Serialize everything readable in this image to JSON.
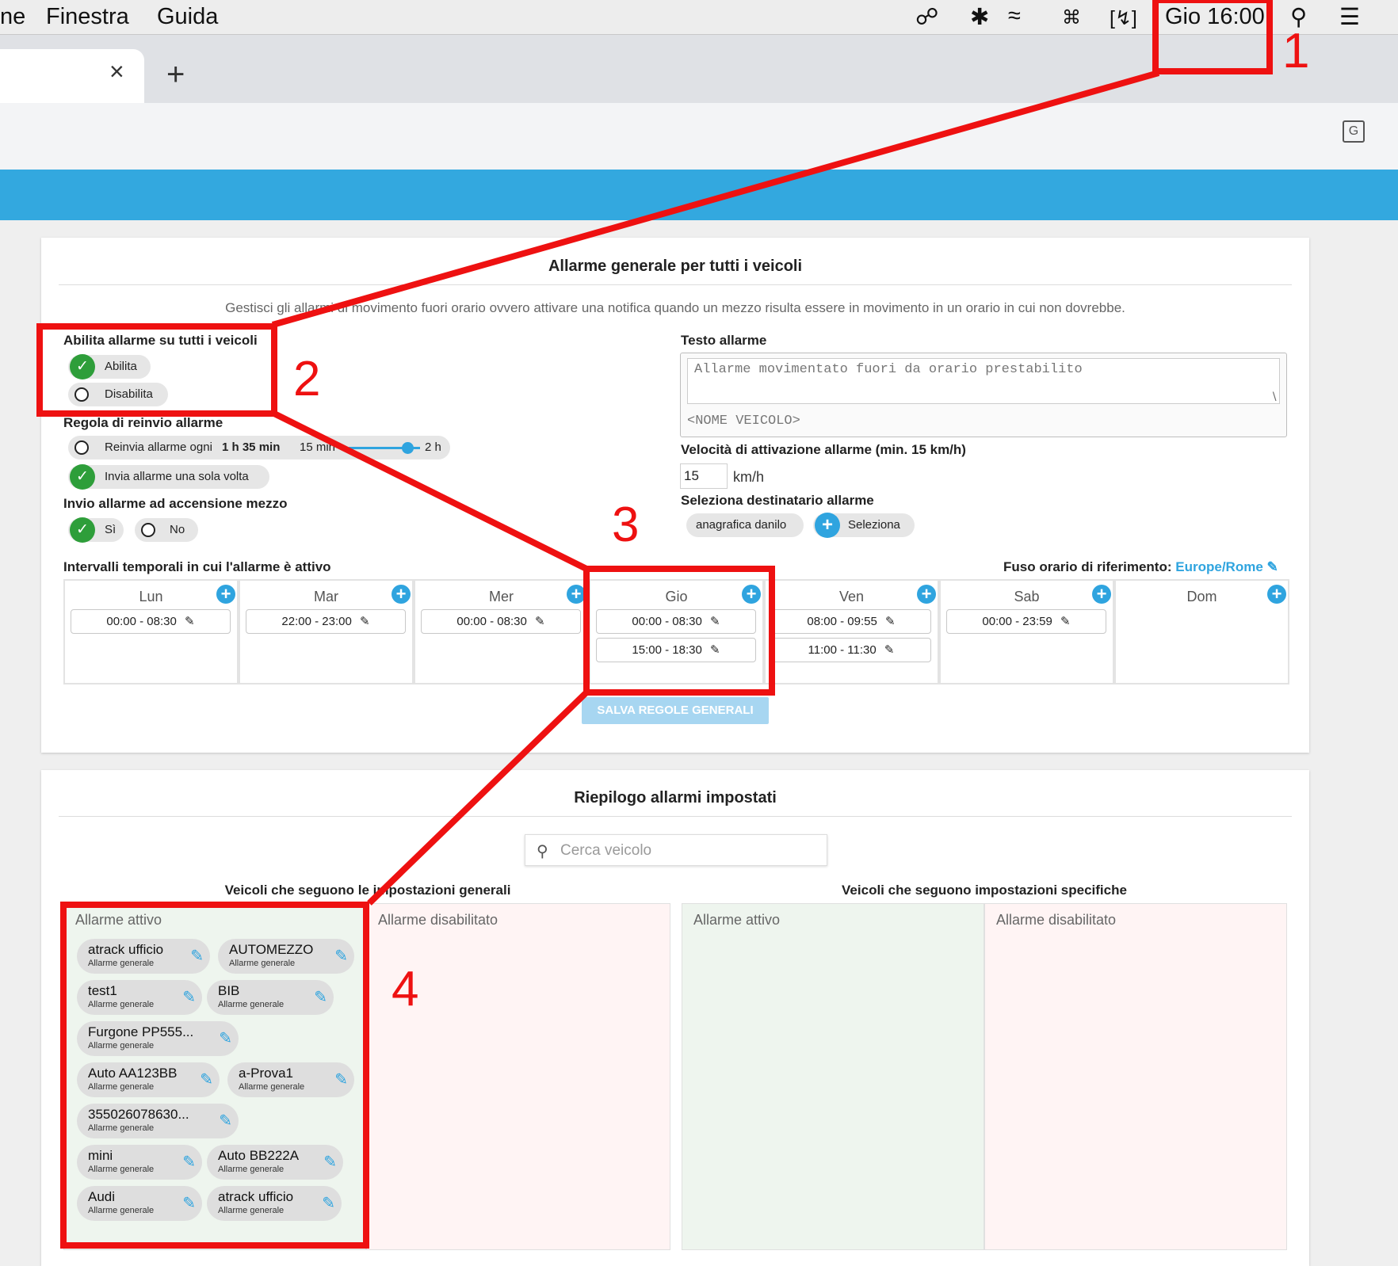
{
  "menubar": {
    "items": [
      "ne",
      "Finestra",
      "Guida"
    ],
    "clock": "Gio 16:00",
    "icons": [
      "creative-cloud-icon",
      "bluetooth-icon",
      "wifi-icon",
      "keyboard-icon",
      "battery-icon",
      "search-icon",
      "list-icon"
    ]
  },
  "browser": {
    "tab_close": "×",
    "new_tab": "+",
    "translate_icon": "G"
  },
  "general": {
    "title": "Allarme generale per tutti i veicoli",
    "description": "Gestisci gli allarmi di movimento fuori orario ovvero attivare una notifica quando un mezzo risulta essere in movimento in un orario in cui non dovrebbe.",
    "enable_label": "Abilita allarme su tutti i veicoli",
    "enable_on": "Abilita",
    "enable_off": "Disabilita",
    "resend_label": "Regola di reinvio allarme",
    "resend_every_prefix": "Reinvia allarme ogni",
    "resend_every_value": "1 h 35 min",
    "slider_min": "15 min",
    "slider_max": "2 h",
    "slider_value": 0.82,
    "resend_once": "Invia allarme una sola volta",
    "ignition_label": "Invio allarme ad accensione mezzo",
    "ignition_yes": "Sì",
    "ignition_no": "No",
    "alarm_text_label": "Testo allarme",
    "alarm_text_value": "Allarme movimentato fuori da orario prestabilito",
    "alarm_text_footer": "<NOME VEICOLO>",
    "speed_label": "Velocità di attivazione allarme (min. 15 km/h)",
    "speed_value": "15",
    "speed_unit": "km/h",
    "recipient_label": "Seleziona destinatario allarme",
    "recipient_chip": "anagrafica danilo",
    "recipient_select": "Seleziona",
    "intervals_label": "Intervalli temporali in cui l'allarme è attivo",
    "timezone_label": "Fuso orario di riferimento:",
    "timezone_value": "Europe/Rome",
    "days": [
      {
        "name": "Lun",
        "slots": [
          "00:00 - 08:30"
        ]
      },
      {
        "name": "Mar",
        "slots": [
          "22:00 - 23:00"
        ]
      },
      {
        "name": "Mer",
        "slots": [
          "00:00 - 08:30"
        ]
      },
      {
        "name": "Gio",
        "slots": [
          "00:00 - 08:30",
          "15:00 - 18:30"
        ]
      },
      {
        "name": "Ven",
        "slots": [
          "08:00 - 09:55",
          "11:00 - 11:30"
        ]
      },
      {
        "name": "Sab",
        "slots": [
          "00:00 - 23:59"
        ]
      },
      {
        "name": "Dom",
        "slots": []
      }
    ],
    "save_button": "SALVA REGOLE GENERALI"
  },
  "summary": {
    "title": "Riepilogo allarmi impostati",
    "search_placeholder": "Cerca veicolo",
    "general_group": "Veicoli che seguono le impostazioni generali",
    "specific_group": "Veicoli che seguono impostazioni specifiche",
    "active": "Allarme attivo",
    "disabled": "Allarme disabilitato",
    "vehicles": [
      {
        "name": "atrack ufficio",
        "sub": "Allarme generale"
      },
      {
        "name": "AUTOMEZZO",
        "sub": "Allarme generale"
      },
      {
        "name": "test1",
        "sub": "Allarme generale"
      },
      {
        "name": "BIB",
        "sub": "Allarme generale"
      },
      {
        "name": "Furgone PP555...",
        "sub": "Allarme generale"
      },
      {
        "name": "Auto AA123BB",
        "sub": "Allarme generale"
      },
      {
        "name": "a-Prova1",
        "sub": "Allarme generale"
      },
      {
        "name": "355026078630...",
        "sub": "Allarme generale"
      },
      {
        "name": "mini",
        "sub": "Allarme generale"
      },
      {
        "name": "Auto BB222A",
        "sub": "Allarme generale"
      },
      {
        "name": "Audi",
        "sub": "Allarme generale"
      },
      {
        "name": "atrack ufficio",
        "sub": "Allarme generale"
      }
    ]
  },
  "annotations": [
    "1",
    "2",
    "3",
    "4"
  ],
  "colors": {
    "accent": "#33a8df",
    "annotation": "#ee1111",
    "check": "#2e9e3a"
  }
}
